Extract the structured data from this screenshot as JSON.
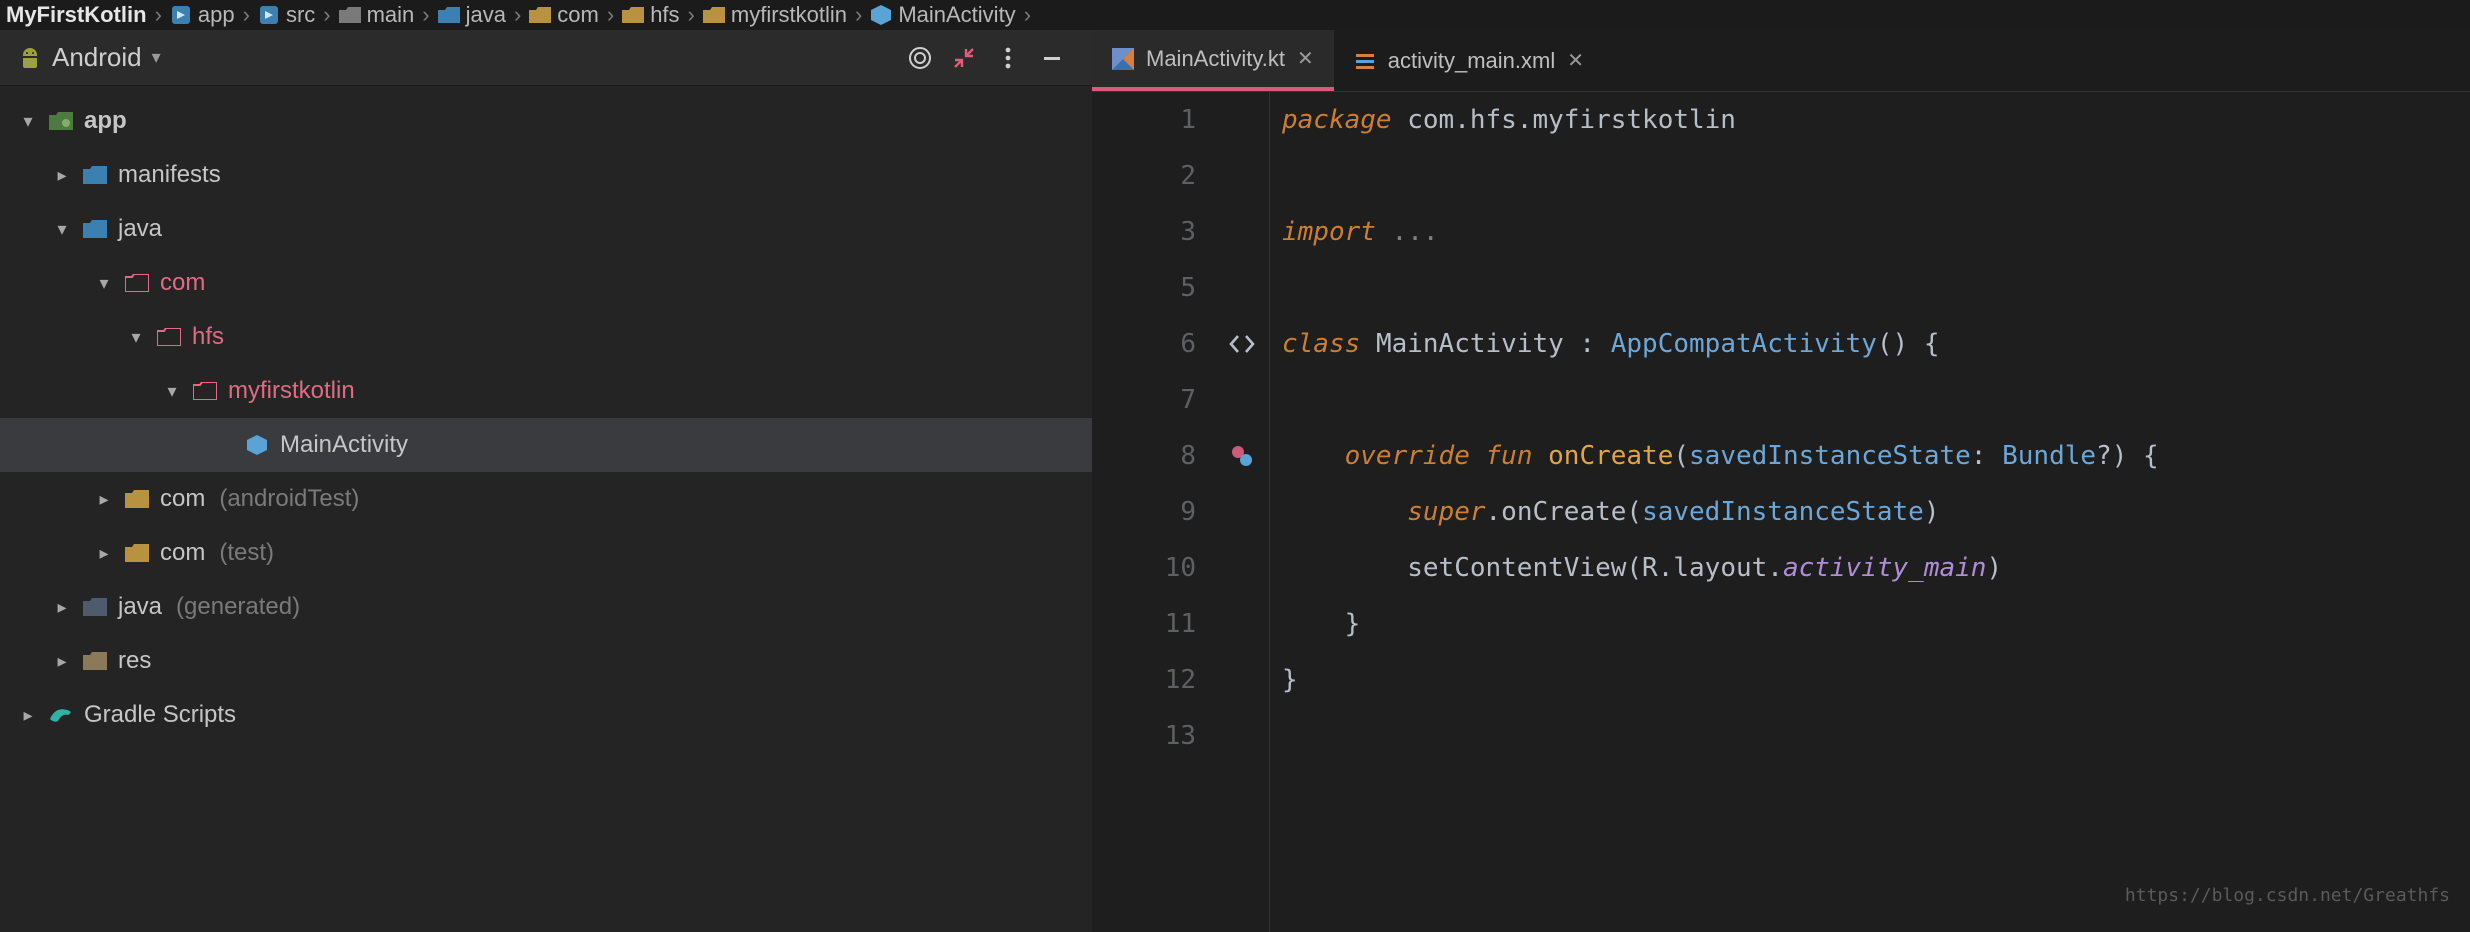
{
  "breadcrumb": [
    {
      "label": "MyFirstKotlin",
      "icon": "module",
      "bold": true
    },
    {
      "label": "app",
      "icon": "module-blue"
    },
    {
      "label": "src",
      "icon": "module-blue"
    },
    {
      "label": "main",
      "icon": "folder-gray"
    },
    {
      "label": "java",
      "icon": "folder-blue"
    },
    {
      "label": "com",
      "icon": "package"
    },
    {
      "label": "hfs",
      "icon": "package"
    },
    {
      "label": "myfirstkotlin",
      "icon": "package"
    },
    {
      "label": "MainActivity",
      "icon": "class-blue"
    }
  ],
  "sidebar": {
    "view_label": "Android",
    "tree": {
      "label": "app",
      "icon": "module-green",
      "children": [
        {
          "label": "manifests",
          "icon": "folder-blue",
          "collapsed": true
        },
        {
          "label": "java",
          "icon": "folder-blue",
          "children": [
            {
              "label": "com",
              "icon": "folder-pink",
              "pink": true,
              "children": [
                {
                  "label": "hfs",
                  "icon": "folder-pink",
                  "pink": true,
                  "children": [
                    {
                      "label": "myfirstkotlin",
                      "icon": "folder-pink",
                      "pink": true,
                      "children": [
                        {
                          "label": "MainActivity",
                          "icon": "class-blue",
                          "selected": true,
                          "leaf": true
                        }
                      ]
                    }
                  ]
                }
              ]
            },
            {
              "label": "com",
              "hint": "(androidTest)",
              "icon": "package",
              "collapsed": true
            },
            {
              "label": "com",
              "hint": "(test)",
              "icon": "package",
              "collapsed": true
            }
          ]
        },
        {
          "label": "java",
          "hint": "(generated)",
          "icon": "folder-dim",
          "collapsed": true
        },
        {
          "label": "res",
          "icon": "folder-tan",
          "collapsed": true
        }
      ]
    },
    "gradle": {
      "label": "Gradle Scripts",
      "icon": "gradle"
    }
  },
  "tabs": [
    {
      "label": "MainActivity.kt",
      "icon": "kotlin",
      "active": true,
      "closable": true
    },
    {
      "label": "activity_main.xml",
      "icon": "xml",
      "active": false,
      "closable": true
    }
  ],
  "code": {
    "lines": [
      "1",
      "2",
      "3",
      "5",
      "6",
      "7",
      "8",
      "9",
      "10",
      "11",
      "12",
      "13"
    ],
    "tokens": {
      "l1_package": "package",
      "l1_pkg": "com.hfs.myfirstkotlin",
      "l3_import": "import",
      "l3_dots": "...",
      "l6_class": "class",
      "l6_name": "MainActivity",
      "l6_colon": " : ",
      "l6_super": "AppCompatActivity",
      "l6_paren": "()",
      "l6_brace": " {",
      "l8_override": "override",
      "l8_fun": "fun",
      "l8_fn": "onCreate",
      "l8_open": "(",
      "l8_p_name": "savedInstanceState",
      "l8_p_colon": ": ",
      "l8_p_type": "Bundle",
      "l8_q": "?",
      "l8_close": ")",
      "l8_brace": " {",
      "l9_super": "super",
      "l9_dot": ".",
      "l9_call": "onCreate",
      "l9_open": "(",
      "l9_arg": "savedInstanceState",
      "l9_close": ")",
      "l10_fn": "setContentView",
      "l10_open": "(",
      "l10_R": "R",
      "l10_d1": ".",
      "l10_layout": "layout",
      "l10_d2": ".",
      "l10_res": "activity_main",
      "l10_close": ")",
      "l11_brace": "}",
      "l12_brace": "}"
    }
  },
  "watermark": "https://blog.csdn.net/Greathfs",
  "colors": {
    "accent": "#db5a7b",
    "pink": "#e06b85",
    "blue": "#6ca7d8",
    "orange": "#cc7f32",
    "purple": "#b18cd9",
    "yellow": "#e0a44a"
  }
}
